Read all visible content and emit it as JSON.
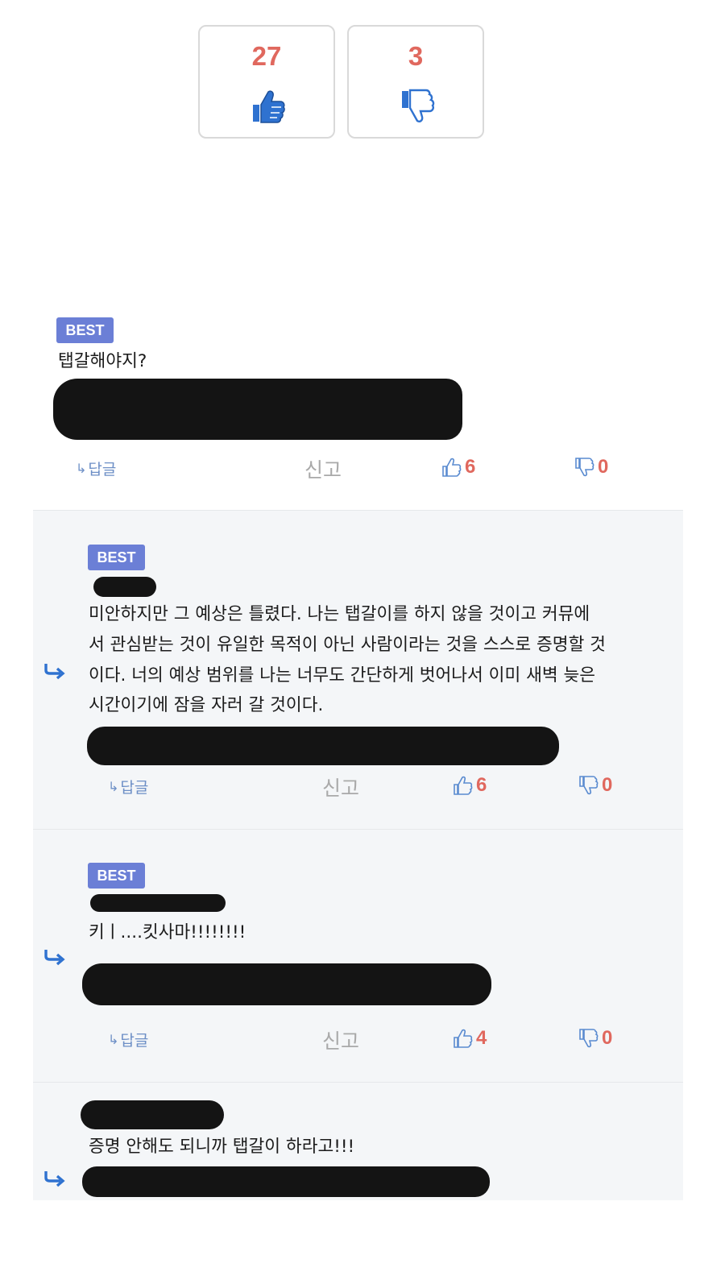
{
  "votes": {
    "up_count": "27",
    "down_count": "3",
    "up_icon": "thumbs-up-icon",
    "down_icon": "thumbs-down-icon",
    "accent_count": "#e0685e",
    "accent_icon": "#2f72d0"
  },
  "comments": [
    {
      "badge": "BEST",
      "lines": [
        "탭갈해야지?"
      ],
      "actions": {
        "reply": "답글",
        "report": "신고",
        "likes": "6",
        "dislikes": "0"
      }
    },
    {
      "badge": "BEST",
      "lines": [
        "미안하지만 그 예상은 틀렸다. 나는 탭갈이를 하지 않을 것이고 커뮤에",
        "서 관심받는 것이 유일한 목적이 아닌 사람이라는 것을 스스로 증명할 것",
        "이다. 너의 예상 범위를 나는 너무도 간단하게 벗어나서 이미 새벽 늦은",
        "시간이기에 잠을 자러 갈 것이다."
      ],
      "actions": {
        "reply": "답글",
        "report": "신고",
        "likes": "6",
        "dislikes": "0"
      }
    },
    {
      "badge": "BEST",
      "lines": [
        "키ㅣ....킷사마!!!!!!!!"
      ],
      "actions": {
        "reply": "답글",
        "report": "신고",
        "likes": "4",
        "dislikes": "0"
      }
    },
    {
      "lines": [
        "증명 안해도 되니까 탭갈이 하라고!!!"
      ]
    }
  ]
}
